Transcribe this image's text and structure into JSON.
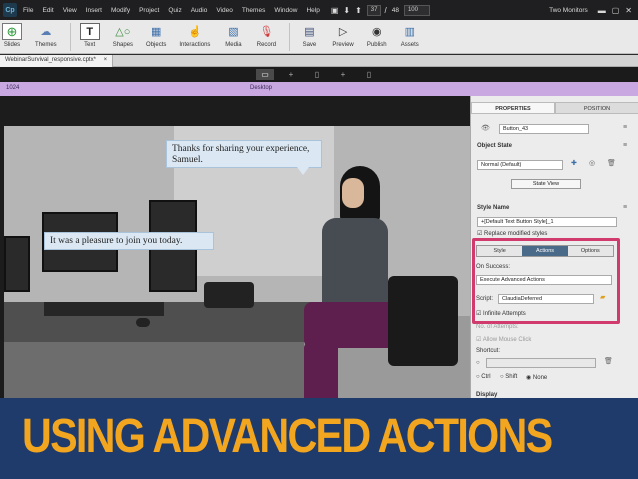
{
  "app": {
    "logo": "Cp"
  },
  "menu": [
    "File",
    "Edit",
    "View",
    "Insert",
    "Modify",
    "Project",
    "Quiz",
    "Audio",
    "Video",
    "Themes",
    "Window",
    "Help"
  ],
  "slide_nav": {
    "current": "37",
    "total": "48",
    "zoom": "100"
  },
  "workspace_mode": "Two Monitors",
  "toolbar": {
    "items": [
      {
        "label": "Slides",
        "icon": "add-slide-icon"
      },
      {
        "label": "Themes",
        "icon": "themes-icon"
      },
      {
        "label": "Text",
        "icon": "text-icon"
      },
      {
        "label": "Shapes",
        "icon": "shapes-icon"
      },
      {
        "label": "Objects",
        "icon": "objects-icon"
      },
      {
        "label": "Interactions",
        "icon": "interactions-icon"
      },
      {
        "label": "Media",
        "icon": "media-icon"
      },
      {
        "label": "Record",
        "icon": "microphone-icon"
      },
      {
        "label": "Save",
        "icon": "save-icon"
      },
      {
        "label": "Preview",
        "icon": "preview-icon"
      },
      {
        "label": "Publish",
        "icon": "publish-icon"
      },
      {
        "label": "Assets",
        "icon": "assets-icon"
      }
    ]
  },
  "document": {
    "tab": "WebinarSurvival_responsive.cptx*",
    "close": "×"
  },
  "ruler": {
    "left_label": "1024",
    "center_label": "Desktop"
  },
  "slide": {
    "bubble1": "Thanks for sharing your experience, Samuel.",
    "bubble2": "It was a pleasure to join you today."
  },
  "panel": {
    "tabs": [
      "PROPERTIES",
      "POSITION"
    ],
    "object_name": "Button_43",
    "object_state_label": "Object State",
    "state_value": "Normal (Default)",
    "state_view_button": "State View",
    "style_name_label": "Style Name",
    "style_value": "+[Default Text Button Style]_1",
    "replace_styles": "Replace modified styles",
    "subtabs": [
      "Style",
      "Actions",
      "Options"
    ],
    "on_success_label": "On Success:",
    "on_success_value": "Execute Advanced Actions",
    "script_label": "Script:",
    "script_value": "ClaudiaDeferred",
    "infinite_attempts": "Infinite Attempts",
    "no_attempts": "No. of Attempts:",
    "allow_mouse_click": "Allow Mouse Click",
    "shortcut_label": "Shortcut:",
    "modifiers": [
      "Ctrl",
      "Shift",
      "None"
    ],
    "display_label": "Display"
  },
  "banner": {
    "title": "USING ADVANCED ACTIONS"
  },
  "colors": {
    "banner_bg": "#1f3b6c",
    "banner_text": "#f2a51f",
    "highlight": "#d13a6d",
    "ruler": "#c9a7e0"
  }
}
